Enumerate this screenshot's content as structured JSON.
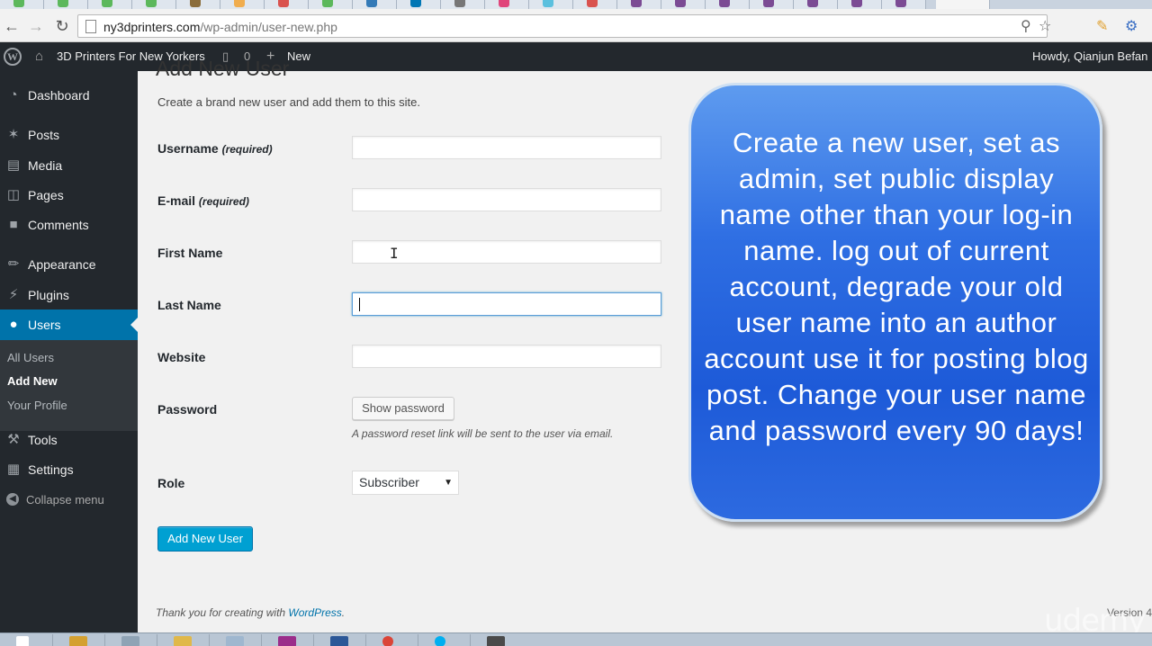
{
  "browser": {
    "url_host": "ny3dprinters.com",
    "url_path": "/wp-admin/user-new.php"
  },
  "adminbar": {
    "site_name": "3D Printers For New Yorkers",
    "comments_count": "0",
    "new_label": "New",
    "greeting": "Howdy, Qianjun Befan"
  },
  "sidebar": {
    "items": [
      {
        "label": "Dashboard",
        "icon": "dashboard-icon"
      },
      {
        "label": "Posts",
        "icon": "pin-icon"
      },
      {
        "label": "Media",
        "icon": "media-icon"
      },
      {
        "label": "Pages",
        "icon": "pages-icon"
      },
      {
        "label": "Comments",
        "icon": "comment-icon"
      },
      {
        "label": "Appearance",
        "icon": "paintbrush-icon"
      },
      {
        "label": "Plugins",
        "icon": "plugin-icon"
      },
      {
        "label": "Users",
        "icon": "users-icon"
      },
      {
        "label": "Tools",
        "icon": "wrench-icon"
      },
      {
        "label": "Settings",
        "icon": "settings-icon"
      }
    ],
    "submenu": [
      "All Users",
      "Add New",
      "Your Profile"
    ],
    "collapse_label": "Collapse menu"
  },
  "form": {
    "title": "Add New User",
    "intro": "Create a brand new user and add them to this site.",
    "username_label": "Username",
    "email_label": "E-mail",
    "required_tag": "(required)",
    "first_name_label": "First Name",
    "last_name_label": "Last Name",
    "website_label": "Website",
    "password_label": "Password",
    "show_password_label": "Show password",
    "password_note": "A password reset link will be sent to the user via email.",
    "role_label": "Role",
    "role_value": "Subscriber",
    "submit_label": "Add New User"
  },
  "footer": {
    "thanks_prefix": "Thank you for creating with ",
    "wordpress_link": "WordPress",
    "thanks_suffix": ".",
    "version": "Version 4"
  },
  "callout": {
    "text": "Create a new user, set as admin, set public display name other than your log-in name. log out of current account, degrade your old user name into an author account use it for posting blog post. Change your user name and password every 90 days!"
  },
  "watermark": "udemy",
  "colors": {
    "admin_bar": "#23282d",
    "accent": "#0073aa",
    "primary_button": "#00a0d2",
    "callout_blue": "#1d5ad8"
  }
}
